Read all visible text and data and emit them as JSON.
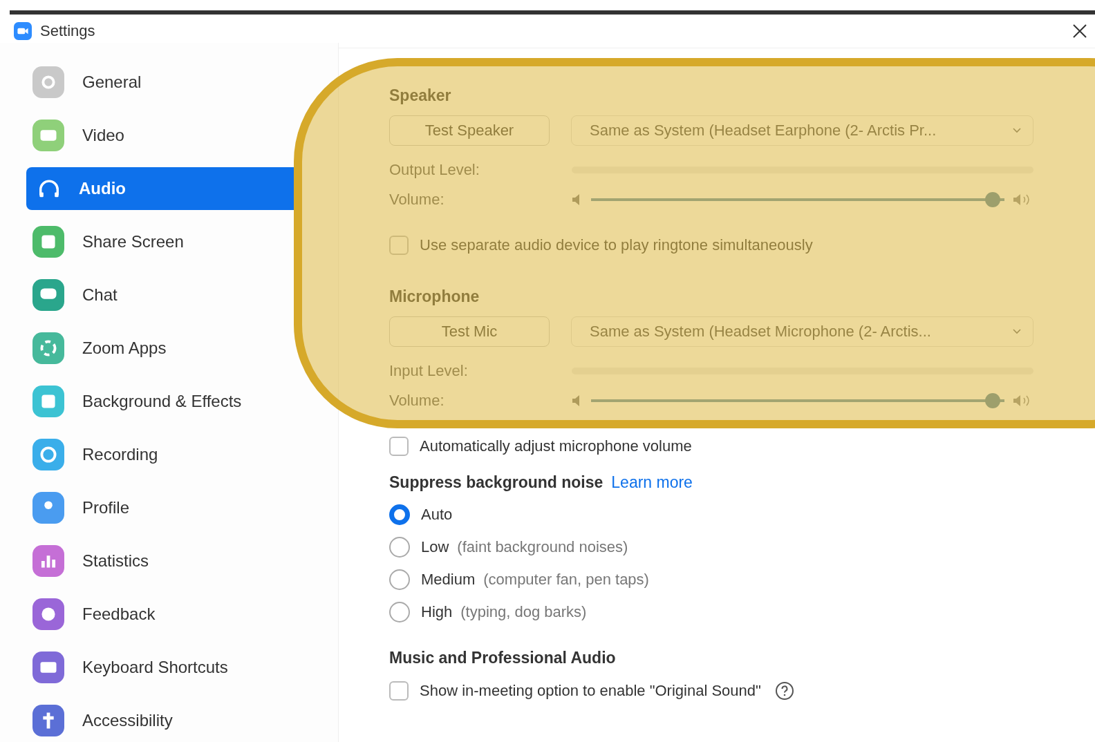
{
  "window": {
    "title": "Settings"
  },
  "sidebar": {
    "items": [
      {
        "label": "General",
        "selected": false
      },
      {
        "label": "Video",
        "selected": false
      },
      {
        "label": "Audio",
        "selected": true
      },
      {
        "label": "Share Screen",
        "selected": false
      },
      {
        "label": "Chat",
        "selected": false
      },
      {
        "label": "Zoom Apps",
        "selected": false
      },
      {
        "label": "Background & Effects",
        "selected": false
      },
      {
        "label": "Recording",
        "selected": false
      },
      {
        "label": "Profile",
        "selected": false
      },
      {
        "label": "Statistics",
        "selected": false
      },
      {
        "label": "Feedback",
        "selected": false
      },
      {
        "label": "Keyboard Shortcuts",
        "selected": false
      },
      {
        "label": "Accessibility",
        "selected": false
      }
    ]
  },
  "speaker": {
    "heading": "Speaker",
    "test_button": "Test Speaker",
    "device": "Same as System (Headset Earphone (2- Arctis Pr...",
    "level_label": "Output Level:",
    "volume_label": "Volume:",
    "volume": {
      "level": 0.99
    },
    "ringtone": {
      "label": "Use separate audio device to play ringtone simultaneously",
      "checked": false
    }
  },
  "microphone": {
    "heading": "Microphone",
    "test_button": "Test Mic",
    "device": "Same as System (Headset Microphone (2- Arctis...",
    "level_label": "Input Level:",
    "volume_label": "Volume:",
    "volume": {
      "level": 0.99
    }
  },
  "auto_adjust": {
    "label": "Automatically adjust microphone volume",
    "checked": false
  },
  "noise": {
    "heading": "Suppress background noise",
    "link": "Learn more",
    "options": [
      {
        "label": "Auto",
        "selected": true
      },
      {
        "label": "Low",
        "hint": "(faint background noises)",
        "selected": false
      },
      {
        "label": "Medium",
        "hint": "(computer fan, pen taps)",
        "selected": false
      },
      {
        "label": "High",
        "hint": "(typing, dog barks)",
        "selected": false
      }
    ]
  },
  "music": {
    "heading": "Music and Professional Audio",
    "original_sound": {
      "label": "Show in-meeting option to enable \"Original Sound\"",
      "checked": false
    }
  }
}
